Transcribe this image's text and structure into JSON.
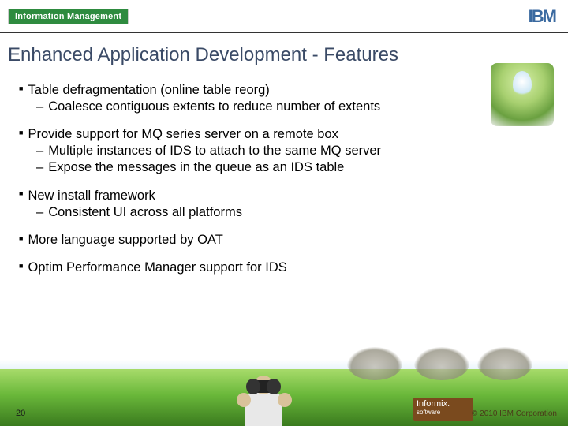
{
  "header": {
    "badge": "Information Management",
    "logo_text": "IBM"
  },
  "title": "Enhanced Application Development  - Features",
  "bullets": [
    {
      "head": "Table defragmentation (online table reorg)",
      "subs": [
        "Coalesce contiguous extents to reduce number of extents"
      ]
    },
    {
      "head": "Provide support for MQ series server on a remote box",
      "subs": [
        "Multiple instances of IDS to attach to the same MQ server",
        "Expose the messages in the queue as an IDS table"
      ]
    },
    {
      "head": "New install framework",
      "subs": [
        "Consistent UI across all platforms"
      ]
    },
    {
      "head": "More language supported by OAT",
      "subs": []
    },
    {
      "head": "Optim Performance Manager support for IDS",
      "subs": []
    }
  ],
  "footer": {
    "page_number": "20",
    "copyright": "© 2010 IBM Corporation",
    "product_logo_line1": "Informix",
    "product_logo_line2": "software"
  }
}
